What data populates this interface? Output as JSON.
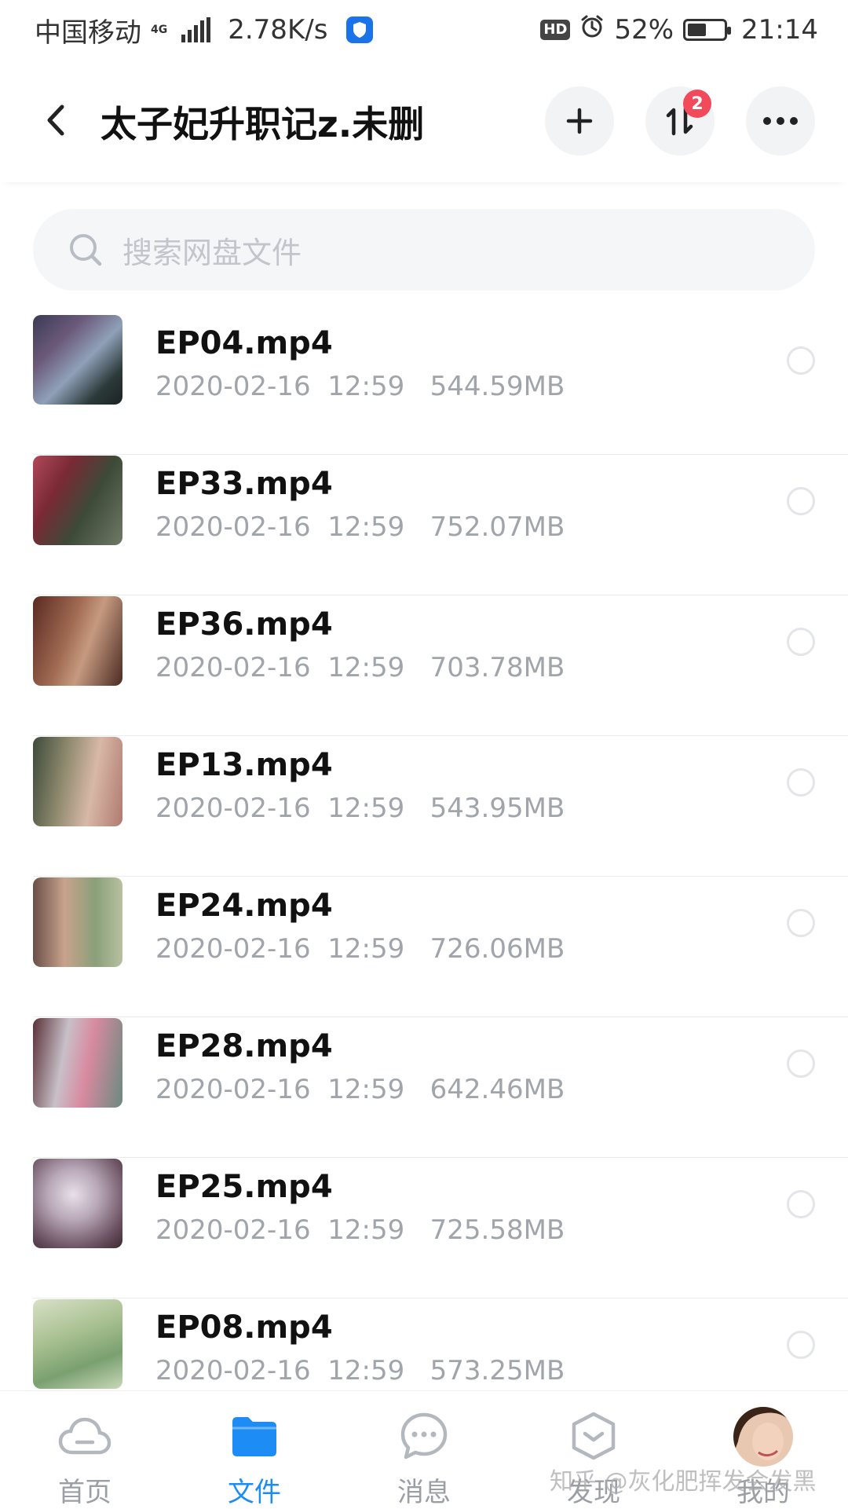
{
  "status_bar": {
    "carrier": "中国移动",
    "network": "4G",
    "speed": "2.78K/s",
    "hd": "HD",
    "battery": "52%",
    "battery_level": 0.52,
    "time": "21:14"
  },
  "header": {
    "title": "太子妃升职记z.未删",
    "transfer_badge": "2"
  },
  "search": {
    "placeholder": "搜索网盘文件"
  },
  "files": [
    {
      "name": "EP04.mp4",
      "date": "2020-02-16",
      "time": "12:59",
      "size": "544.59MB"
    },
    {
      "name": "EP33.mp4",
      "date": "2020-02-16",
      "time": "12:59",
      "size": "752.07MB"
    },
    {
      "name": "EP36.mp4",
      "date": "2020-02-16",
      "time": "12:59",
      "size": "703.78MB"
    },
    {
      "name": "EP13.mp4",
      "date": "2020-02-16",
      "time": "12:59",
      "size": "543.95MB"
    },
    {
      "name": "EP24.mp4",
      "date": "2020-02-16",
      "time": "12:59",
      "size": "726.06MB"
    },
    {
      "name": "EP28.mp4",
      "date": "2020-02-16",
      "time": "12:59",
      "size": "642.46MB"
    },
    {
      "name": "EP25.mp4",
      "date": "2020-02-16",
      "time": "12:59",
      "size": "725.58MB"
    },
    {
      "name": "EP08.mp4",
      "date": "2020-02-16",
      "time": "12:59",
      "size": "573.25MB"
    }
  ],
  "nav": {
    "items": [
      {
        "label": "首页",
        "icon": "cloud-icon"
      },
      {
        "label": "文件",
        "icon": "folder-icon"
      },
      {
        "label": "消息",
        "icon": "chat-icon"
      },
      {
        "label": "发现",
        "icon": "discover-icon"
      },
      {
        "label": "我的",
        "icon": "avatar"
      }
    ],
    "active_index": 1
  },
  "watermark": "知乎 @灰化肥挥发会发黑",
  "colors": {
    "accent": "#1e8cf5",
    "badge": "#f2495b"
  }
}
